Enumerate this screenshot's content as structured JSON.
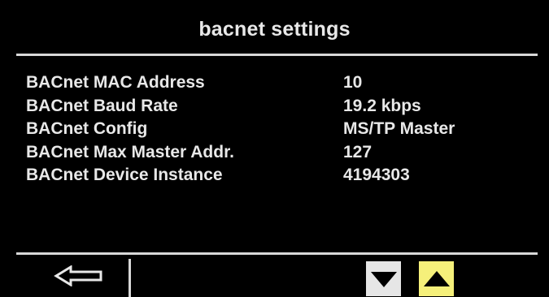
{
  "screen": {
    "title": "bacnet settings"
  },
  "settings": [
    {
      "label": "BACnet MAC Address",
      "value": "10"
    },
    {
      "label": "BACnet Baud Rate",
      "value": "19.2 kbps"
    },
    {
      "label": "BACnet Config",
      "value": "MS/TP Master"
    },
    {
      "label": "BACnet Max Master Addr.",
      "value": "127"
    },
    {
      "label": "BACnet Device Instance",
      "value": "4194303"
    }
  ],
  "footer": {
    "back_icon": "left-arrow-outline-icon",
    "down_icon": "triangle-down-icon",
    "up_icon": "triangle-up-icon",
    "down_button_color": "#e6e6e6",
    "up_button_color": "#f5f07a"
  },
  "colors": {
    "background": "#000000",
    "text": "#e8e8e8",
    "rule": "#d8d8d8"
  }
}
